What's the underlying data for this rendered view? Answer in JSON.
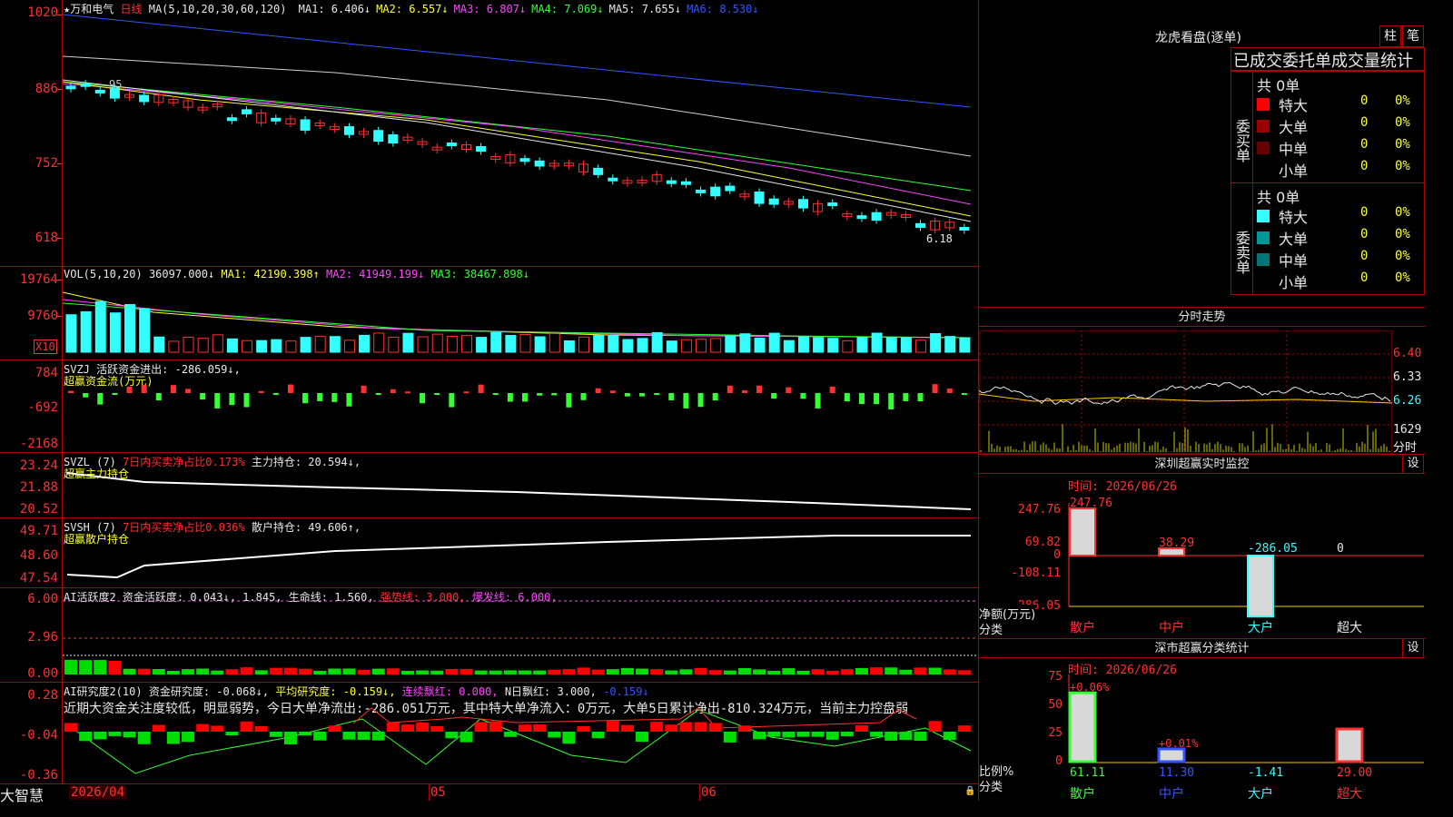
{
  "stock": {
    "name": "★万和电气",
    "period": "日线",
    "ma_label": "MA(5,10,20,30,60,120)",
    "ma": [
      {
        "name": "MA1:",
        "value": "6.406↓",
        "color": "#e8e8e8"
      },
      {
        "name": "MA2:",
        "value": "6.557↓",
        "color": "#ffff33"
      },
      {
        "name": "MA3:",
        "value": "6.807↓",
        "color": "#ff44ff"
      },
      {
        "name": "MA4:",
        "value": "7.069↓",
        "color": "#33ff33"
      },
      {
        "name": "MA5:",
        "value": "7.655↓",
        "color": "#e8e8e8"
      },
      {
        "name": "MA6:",
        "value": "8.530↓",
        "color": "#3355ff"
      }
    ],
    "price_axis": [
      "1020",
      "886",
      "752",
      "618"
    ],
    "last_price_label": "6.18",
    "hi_label": "95"
  },
  "vol": {
    "label": "VOL(5,10,20)",
    "value": "36097.000↓",
    "ma1": "MA1: 42190.398↑",
    "ma2": "MA2: 41949.199↓",
    "ma3": "MA3: 38467.898↓",
    "axis": [
      "19764",
      "9760"
    ],
    "unit": "X10"
  },
  "svzj": {
    "label": "SVZJ",
    "text": "活跃资金进出: -286.059↓,",
    "sub": "超赢资金流(万元)",
    "axis": [
      "784",
      "-692",
      "-2168"
    ]
  },
  "svzl": {
    "label": "SVZL (7)",
    "ratio": "7日内买卖净占比0.173%",
    "text": "主力持仓: 20.594↓,",
    "sub": "超赢主力持仓",
    "axis": [
      "23.24",
      "21.88",
      "20.52"
    ]
  },
  "svsh": {
    "label": "SVSH (7)",
    "ratio": "7日内买卖净占比0.036%",
    "text": "散户持仓: 49.606↑,",
    "sub": "超赢散户持仓",
    "axis": [
      "49.71",
      "48.60",
      "47.54"
    ]
  },
  "ai1": {
    "label": "AI活跃度2",
    "text": "资金活跃度: 0.043↓, 1.845, 生命线: 1.560,",
    "strong": "强势线: 3.000,",
    "burst": "爆发线: 6.000,",
    "axis": [
      "6.00",
      "2.96",
      "0.00"
    ]
  },
  "ai2": {
    "label": "AI研究度2(10)",
    "text": "资金研究度: -0.068↓,",
    "avg": "平均研究度: -0.159↓,",
    "red": "连续飘红: 0.000,",
    "nred": "N日飘红: 3.000,",
    "last": "-0.159↓",
    "comment": "近期大资金关注度较低，明显弱势，今日大单净流出:-286.051万元，其中特大单净流入：0万元，大单5日累计净出-810.324万元，当前主力控盘弱",
    "axis": [
      "0.28",
      "-0.04",
      "-0.36"
    ]
  },
  "date_axis": [
    "2026/04",
    "05",
    "06"
  ],
  "brand": "大智慧",
  "longhu": {
    "title": "龙虎看盘(逐单)",
    "btn1": "柱",
    "btn2": "笔",
    "tabs": "已成交委托单成交量统计",
    "buy_label": "委买单",
    "sell_label": "委卖单",
    "buy_total": "共 0单",
    "sell_total": "共 0单",
    "buy": [
      {
        "name": "特大",
        "count": "0",
        "pct": "0%",
        "color": "#ff0000"
      },
      {
        "name": "大单",
        "count": "0",
        "pct": "0%",
        "color": "#990000"
      },
      {
        "name": "中单",
        "count": "0",
        "pct": "0%",
        "color": "#660000"
      },
      {
        "name": "小单",
        "count": "0",
        "pct": "0%",
        "color": ""
      }
    ],
    "sell": [
      {
        "name": "特大",
        "count": "0",
        "pct": "0%",
        "color": "#33ffff"
      },
      {
        "name": "大单",
        "count": "0",
        "pct": "0%",
        "color": "#009999"
      },
      {
        "name": "中单",
        "count": "0",
        "pct": "0%",
        "color": "#007777"
      },
      {
        "name": "小单",
        "count": "0",
        "pct": "0%",
        "color": ""
      }
    ]
  },
  "fenshi": {
    "title": "分时走势",
    "axis": [
      "6.40",
      "6.33",
      "6.26"
    ],
    "vol_label": "1629",
    "vol_unit": "分时"
  },
  "sz_monitor": {
    "title": "深圳超赢实时监控",
    "set": "设",
    "time": "时间: 2026/06/26",
    "axis": [
      "247.76",
      "69.82",
      "0",
      "-108.11",
      "-286.05"
    ],
    "y_label": "净额(万元)",
    "x_label": "分类",
    "bars": [
      {
        "cat": "散户",
        "value": 247.76,
        "label": "247.76"
      },
      {
        "cat": "中户",
        "value": 38.29,
        "label": "38.29"
      },
      {
        "cat": "大户",
        "value": -286.05,
        "label": "-286.05"
      },
      {
        "cat": "超大",
        "value": 0,
        "label": "0"
      }
    ]
  },
  "sz_stats": {
    "title": "深市超赢分类统计",
    "set": "设",
    "time": "时间: 2026/06/26",
    "axis": [
      "75",
      "50",
      "25",
      "0"
    ],
    "y_label": "比例%",
    "x_label": "分类",
    "bars": [
      {
        "cat": "散户",
        "value": 61.11,
        "label": "61.11",
        "delta": "+0.06%"
      },
      {
        "cat": "中户",
        "value": 11.3,
        "label": "11.30",
        "delta": "+0.01%"
      },
      {
        "cat": "大户",
        "value": -1.41,
        "label": "-1.41",
        "delta": ""
      },
      {
        "cat": "超大",
        "value": 29.0,
        "label": "29.00",
        "delta": ""
      }
    ]
  }
}
